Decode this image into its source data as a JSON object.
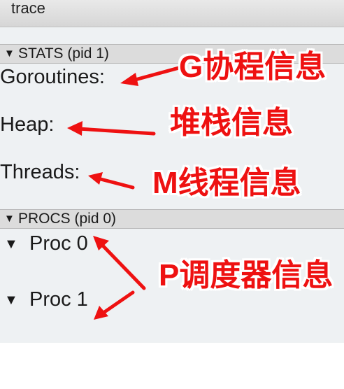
{
  "window": {
    "title": "trace"
  },
  "stats_section": {
    "header": "STATS (pid 1)",
    "rows": [
      "Goroutines:",
      "Heap:",
      "Threads:"
    ]
  },
  "procs_section": {
    "header": "PROCS (pid 0)",
    "rows": [
      "Proc 0",
      "Proc 1"
    ]
  },
  "annotations": {
    "goroutines": "G协程信息",
    "heap": "堆栈信息",
    "threads": "M线程信息",
    "procs": "P调度器信息"
  },
  "colors": {
    "annotation": "#ee1111",
    "panel": "#eef1f3",
    "header": "#dcdcdc"
  }
}
